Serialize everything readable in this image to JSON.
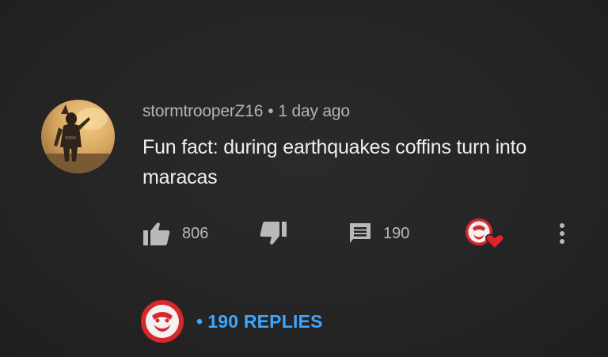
{
  "comment": {
    "author": "stormtrooperZ16",
    "separator": "•",
    "time": "1 day ago",
    "text": "Fun fact: during earthquakes coffins turn into maracas",
    "avatar_icon": "mandalorian-avatar"
  },
  "actions": {
    "likes": "806",
    "replies_count": "190",
    "like_icon": "thumbs-up-icon",
    "dislike_icon": "thumbs-down-icon",
    "reply_icon": "comment-icon",
    "heart_icon": "creator-heart-icon",
    "more_icon": "more-vert-icon"
  },
  "replies": {
    "bullet": "•",
    "label": "190 REPLIES"
  },
  "colors": {
    "background": "#232323",
    "link": "#3ea6ff",
    "text": "#efefef",
    "muted": "#b3b3b3",
    "creator": "#d8282b"
  }
}
